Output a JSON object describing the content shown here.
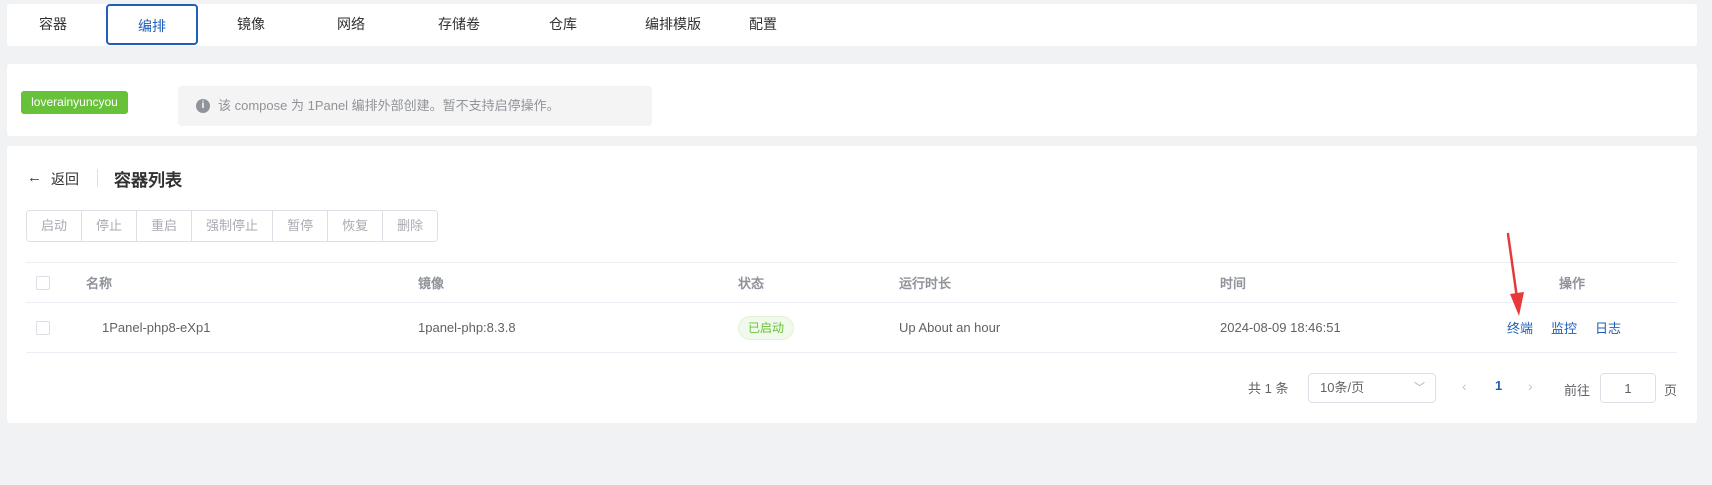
{
  "tabs": [
    {
      "label": "容器",
      "active": false
    },
    {
      "label": "编排",
      "active": true
    },
    {
      "label": "镜像",
      "active": false
    },
    {
      "label": "网络",
      "active": false
    },
    {
      "label": "存储卷",
      "active": false
    },
    {
      "label": "仓库",
      "active": false
    },
    {
      "label": "编排模版",
      "active": false
    },
    {
      "label": "配置",
      "active": false
    }
  ],
  "compose": {
    "tag": "loverainyuncyou",
    "alert_icon": "info-icon",
    "alert_text": "该 compose 为 1Panel 编排外部创建。暂不支持启停操作。"
  },
  "header": {
    "back_label": "返回",
    "title": "容器列表"
  },
  "actions": {
    "buttons": [
      "启动",
      "停止",
      "重启",
      "强制停止",
      "暂停",
      "恢复",
      "删除"
    ],
    "disabled": true
  },
  "table": {
    "columns": [
      "名称",
      "镜像",
      "状态",
      "运行时长",
      "时间",
      "操作"
    ],
    "rows": [
      {
        "name": "1Panel-php8-eXp1",
        "image": "1panel-php:8.3.8",
        "status": "已启动",
        "uptime": "Up About an hour",
        "time": "2024-08-09 18:46:51",
        "ops": [
          "终端",
          "监控",
          "日志"
        ]
      }
    ]
  },
  "pagination": {
    "total": "共 1 条",
    "page_size": "10条/页",
    "current_page": "1",
    "goto_label": "前往",
    "goto_value": "1",
    "page_suffix": "页"
  },
  "colors": {
    "primary": "#1f5fba",
    "success": "#67c23a",
    "annotation": "#e8393a"
  }
}
